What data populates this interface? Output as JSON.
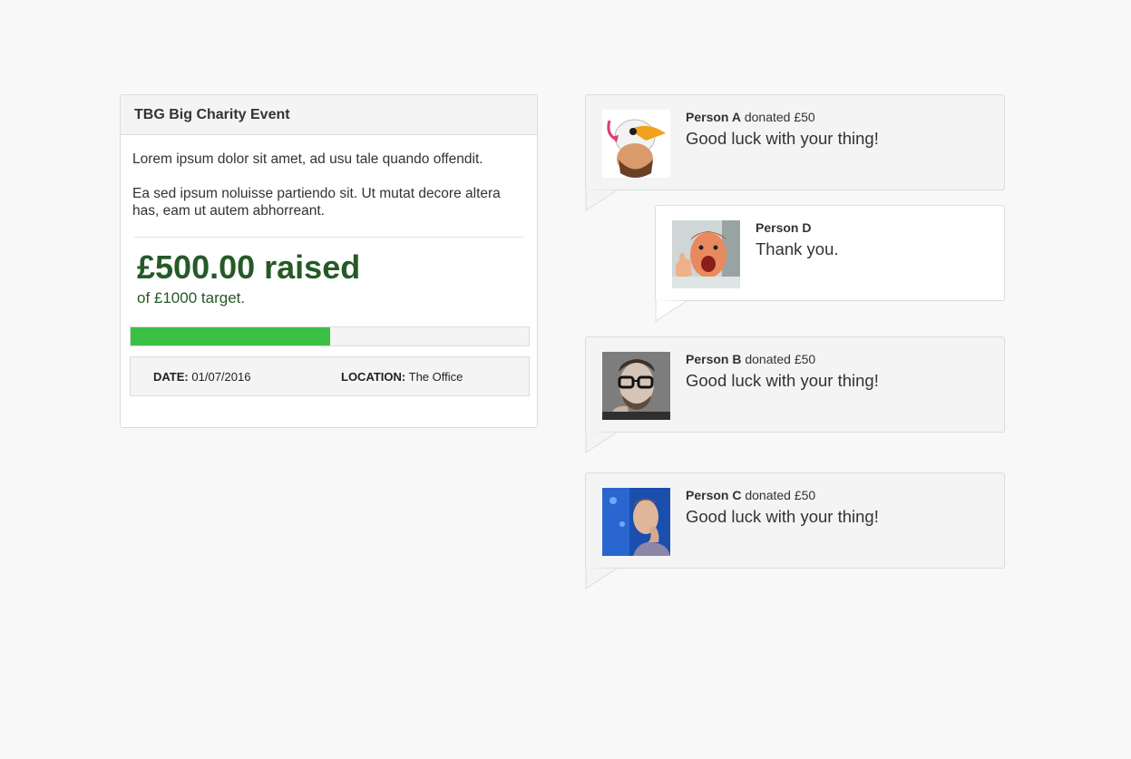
{
  "event": {
    "title": "TBG Big Charity Event",
    "description": [
      "Lorem ipsum dolor sit amet, ad usu tale quando offendit.",
      "Ea sed ipsum noluisse partiendo sit. Ut mutat decore altera has, eam ut autem abhorreant."
    ],
    "raised": "£500.00 raised",
    "target": "of £1000 target.",
    "progress_fraction": 0.5,
    "date_label": "DATE:",
    "date_value": "01/07/2016",
    "location_label": "LOCATION:",
    "location_value": "The Office"
  },
  "feed": [
    {
      "kind": "donation",
      "name": "Person A",
      "action": "donated £50",
      "message": "Good luck with your thing!",
      "avatar": "cartoon-duck-avatar"
    },
    {
      "kind": "reply",
      "name": "Person D",
      "action": "",
      "message": "Thank you.",
      "avatar": "person-thumbs-up-avatar"
    },
    {
      "kind": "donation",
      "name": "Person B",
      "action": "donated £50",
      "message": "Good luck with your thing!",
      "avatar": "person-glasses-avatar"
    },
    {
      "kind": "donation",
      "name": "Person C",
      "action": "donated £50",
      "message": "Good luck with your thing!",
      "avatar": "person-profile-blue-avatar"
    }
  ],
  "colors": {
    "page_background": "#f8f8f8",
    "panel_header": "#f4f4f4",
    "raised_text": "#255a26",
    "progress_fill": "#3cbf45",
    "border": "#dcdcdc"
  }
}
